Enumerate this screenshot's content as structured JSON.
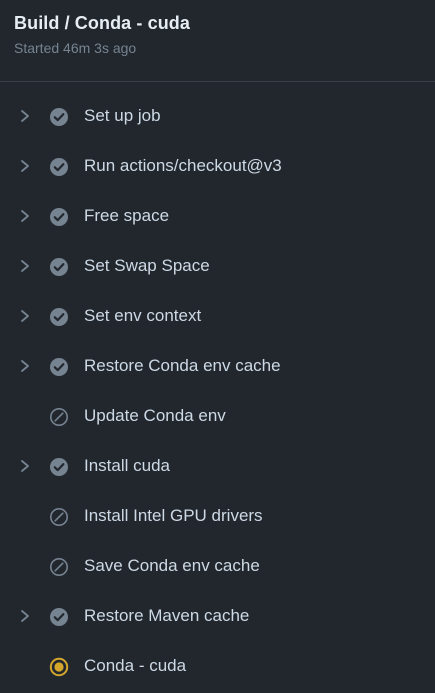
{
  "header": {
    "title": "Build / Conda - cuda",
    "subtitle": "Started 46m 3s ago"
  },
  "colors": {
    "background": "#22272e",
    "success_icon": "#768390",
    "skipped_icon": "#768390",
    "in_progress_icon": "#d4a72c"
  },
  "steps": [
    {
      "label": "Set up job",
      "status": "success",
      "expandable": true
    },
    {
      "label": "Run actions/checkout@v3",
      "status": "success",
      "expandable": true
    },
    {
      "label": "Free space",
      "status": "success",
      "expandable": true
    },
    {
      "label": "Set Swap Space",
      "status": "success",
      "expandable": true
    },
    {
      "label": "Set env context",
      "status": "success",
      "expandable": true
    },
    {
      "label": "Restore Conda env cache",
      "status": "success",
      "expandable": true
    },
    {
      "label": "Update Conda env",
      "status": "skipped",
      "expandable": false
    },
    {
      "label": "Install cuda",
      "status": "success",
      "expandable": true
    },
    {
      "label": "Install Intel GPU drivers",
      "status": "skipped",
      "expandable": false
    },
    {
      "label": "Save Conda env cache",
      "status": "skipped",
      "expandable": false
    },
    {
      "label": "Restore Maven cache",
      "status": "success",
      "expandable": true
    },
    {
      "label": "Conda - cuda",
      "status": "in-progress",
      "expandable": false
    }
  ]
}
